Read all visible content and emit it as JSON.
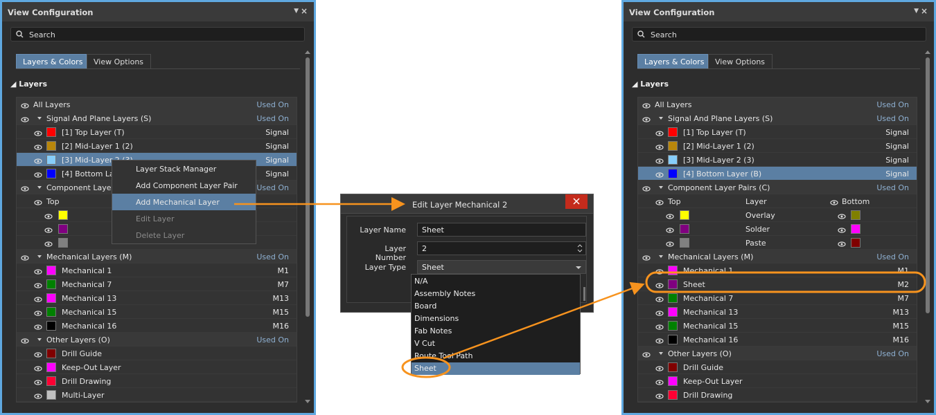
{
  "left_panel": {
    "title": "View Configuration",
    "search_placeholder": "Search",
    "tabs": [
      "Layers & Colors",
      "View Options"
    ],
    "section": "Layers",
    "tree": [
      {
        "type": "header",
        "label": "All Layers",
        "right": "Used On"
      },
      {
        "type": "group",
        "label": "Signal And Plane Layers (S)",
        "right": "Used On"
      },
      {
        "type": "layer",
        "label": "[1] Top Layer (T)",
        "color": "#ff0000",
        "right": "Signal"
      },
      {
        "type": "layer",
        "label": "[2] Mid-Layer 1 (2)",
        "color": "#b8860b",
        "right": "Signal"
      },
      {
        "type": "layer",
        "label": "[3] Mid-Layer 2 (3)",
        "color": "#87cefa",
        "right": "Signal",
        "selected": true
      },
      {
        "type": "layer",
        "label": "[4] Bottom Laye",
        "color": "#0000ff",
        "right": "Signal"
      },
      {
        "type": "group",
        "label": "Component Layer P",
        "right": "Used On"
      },
      {
        "type": "sub",
        "label": "Top"
      },
      {
        "type": "pairrow",
        "color": "#ffff00"
      },
      {
        "type": "pairrow",
        "color": "#800080"
      },
      {
        "type": "pairrow",
        "color": "#808080"
      },
      {
        "type": "group",
        "label": "Mechanical Layers (M)",
        "right": "Used On"
      },
      {
        "type": "layer",
        "label": "Mechanical 1",
        "color": "#ff00ff",
        "right": "M1"
      },
      {
        "type": "layer",
        "label": "Mechanical 7",
        "color": "#008000",
        "right": "M7"
      },
      {
        "type": "layer",
        "label": "Mechanical 13",
        "color": "#ff00ff",
        "right": "M13"
      },
      {
        "type": "layer",
        "label": "Mechanical 15",
        "color": "#008000",
        "right": "M15"
      },
      {
        "type": "layer",
        "label": "Mechanical 16",
        "color": "#000000",
        "right": "M16"
      },
      {
        "type": "group",
        "label": "Other Layers (O)",
        "right": "Used On"
      },
      {
        "type": "layer",
        "label": "Drill Guide",
        "color": "#800000",
        "right": ""
      },
      {
        "type": "layer",
        "label": "Keep-Out Layer",
        "color": "#ff00ff",
        "right": ""
      },
      {
        "type": "layer",
        "label": "Drill Drawing",
        "color": "#ff0033",
        "right": ""
      },
      {
        "type": "layer",
        "label": "Multi-Layer",
        "color": "#c0c0c0",
        "right": ""
      }
    ]
  },
  "context_menu": [
    {
      "label": "Layer Stack Manager",
      "state": "normal"
    },
    {
      "label": "Add Component Layer Pair",
      "state": "normal"
    },
    {
      "label": "Add Mechanical Layer",
      "state": "highlight"
    },
    {
      "label": "Edit Layer",
      "state": "disabled"
    },
    {
      "label": "Delete Layer",
      "state": "disabled"
    }
  ],
  "dialog": {
    "title": "Edit Layer Mechanical 2",
    "layer_name_label": "Layer Name",
    "layer_name_value": "Sheet",
    "layer_number_label": "Layer Number",
    "layer_number_value": "2",
    "layer_type_label": "Layer Type",
    "layer_type_value": "Sheet",
    "type_options": [
      "N/A",
      "Assembly Notes",
      "Board",
      "Dimensions",
      "Fab Notes",
      "V Cut",
      "Route Tool Path",
      "Sheet"
    ],
    "selected_option": "Sheet"
  },
  "right_panel": {
    "title": "View Configuration",
    "search_placeholder": "Search",
    "tabs": [
      "Layers & Colors",
      "View Options"
    ],
    "section": "Layers",
    "tree": [
      {
        "type": "header",
        "label": "All Layers",
        "right": "Used On"
      },
      {
        "type": "group",
        "label": "Signal And Plane Layers (S)",
        "right": "Used On"
      },
      {
        "type": "layer",
        "label": "[1] Top Layer (T)",
        "color": "#ff0000",
        "right": "Signal"
      },
      {
        "type": "layer",
        "label": "[2] Mid-Layer 1 (2)",
        "color": "#b8860b",
        "right": "Signal"
      },
      {
        "type": "layer",
        "label": "[3] Mid-Layer 2 (3)",
        "color": "#87cefa",
        "right": "Signal"
      },
      {
        "type": "layer",
        "label": "[4] Bottom Layer (B)",
        "color": "#0000ff",
        "right": "Signal",
        "selected": true
      },
      {
        "type": "group",
        "label": "Component Layer Pairs (C)",
        "right": "Used On"
      },
      {
        "type": "pairhead",
        "label": "Top",
        "mid": "Layer",
        "label2": "Bottom"
      },
      {
        "type": "pair",
        "c1": "#ffff00",
        "mid": "Overlay",
        "c2": "#808000"
      },
      {
        "type": "pair",
        "c1": "#800080",
        "mid": "Solder",
        "c2": "#ff00ff"
      },
      {
        "type": "pair",
        "c1": "#808080",
        "mid": "Paste",
        "c2": "#800000"
      },
      {
        "type": "group",
        "label": "Mechanical Layers (M)",
        "right": "Used On"
      },
      {
        "type": "layer",
        "label": "Mechanical 1",
        "color": "#ff00ff",
        "right": "M1"
      },
      {
        "type": "layer",
        "label": "Sheet",
        "color": "#800080",
        "right": "M2"
      },
      {
        "type": "layer",
        "label": "Mechanical 7",
        "color": "#008000",
        "right": "M7"
      },
      {
        "type": "layer",
        "label": "Mechanical 13",
        "color": "#ff00ff",
        "right": "M13"
      },
      {
        "type": "layer",
        "label": "Mechanical 15",
        "color": "#008000",
        "right": "M15"
      },
      {
        "type": "layer",
        "label": "Mechanical 16",
        "color": "#000000",
        "right": "M16"
      },
      {
        "type": "group",
        "label": "Other Layers (O)",
        "right": "Used On"
      },
      {
        "type": "layer",
        "label": "Drill Guide",
        "color": "#800000",
        "right": ""
      },
      {
        "type": "layer",
        "label": "Keep-Out Layer",
        "color": "#ff00ff",
        "right": ""
      },
      {
        "type": "layer",
        "label": "Drill Drawing",
        "color": "#ff0033",
        "right": ""
      },
      {
        "type": "layer",
        "label": "",
        "color": "#c0c0c0",
        "right": ""
      }
    ]
  },
  "accent_color": "#f7931e"
}
